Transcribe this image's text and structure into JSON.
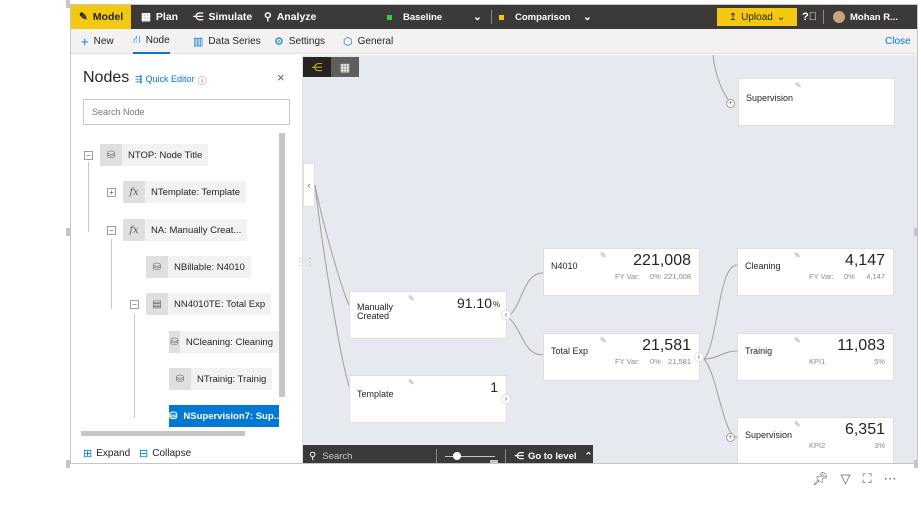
{
  "topbar": {
    "model_label": "Model",
    "plan_label": "Plan",
    "simulate_label": "Simulate",
    "analyze_label": "Analyze",
    "baseline_label": "Baseline",
    "comparison_label": "Comparison",
    "upload_label": "Upload",
    "user_name": "Mohan R..."
  },
  "subbar": {
    "new_label": "New",
    "node_label": "Node",
    "data_series_label": "Data Series",
    "settings_label": "Settings",
    "general_label": "General",
    "close_label": "Close"
  },
  "nodes_panel": {
    "title": "Nodes",
    "quick_editor_label": "Quick Editor",
    "search_placeholder": "Search Node",
    "expand_label": "Expand",
    "collapse_label": "Collapse",
    "tree": [
      {
        "label": "NTOP: Node Title",
        "icon": "cylinder-icon",
        "level": 0
      },
      {
        "label": "NTemplate: Template",
        "icon": "fx-icon",
        "level": 1
      },
      {
        "label": "NA: Manually Creat...",
        "icon": "fx-icon",
        "level": 1
      },
      {
        "label": "NBillable: N4010",
        "icon": "cylinder-icon",
        "level": 2
      },
      {
        "label": "NN4010TE: Total Exp",
        "icon": "calc-icon",
        "level": 2
      },
      {
        "label": "NCleaning: Cleaning",
        "icon": "cylinder-icon",
        "level": 3
      },
      {
        "label": "NTrainig: Trainig",
        "icon": "cylinder-icon",
        "level": 3
      },
      {
        "label": "NSupervision7: Sup...",
        "icon": "cylinder-icon",
        "level": 3,
        "selected": true
      }
    ]
  },
  "canvas": {
    "cards": {
      "supervision_top": {
        "label": "Supervision"
      },
      "manually_created": {
        "label1": "Manually",
        "label2": "Created",
        "value": "91.10",
        "unit": "%"
      },
      "template": {
        "label": "Template",
        "value": "1"
      },
      "n4010": {
        "label": "N4010",
        "value": "221,008",
        "sub_label": "FY Var:",
        "sub_pct": "0%",
        "sub_val": "221,008"
      },
      "total_exp": {
        "label": "Total Exp",
        "value": "21,581",
        "sub_label": "FY Var:",
        "sub_pct": "0%",
        "sub_val": "21,581"
      },
      "cleaning": {
        "label": "Cleaning",
        "value": "4,147",
        "sub_label": "FY Var:",
        "sub_pct": "0%",
        "sub_val": "4,147"
      },
      "trainig": {
        "label": "Trainig",
        "value": "11,083",
        "sub_label": "KPI1",
        "sub_val": "5%"
      },
      "supervision": {
        "label": "Supervision",
        "value": "6,351",
        "sub_label": "KPI2",
        "sub_val": "3%"
      }
    },
    "bottombar": {
      "search_label": "Search",
      "go_to_level_label": "Go to level"
    }
  }
}
